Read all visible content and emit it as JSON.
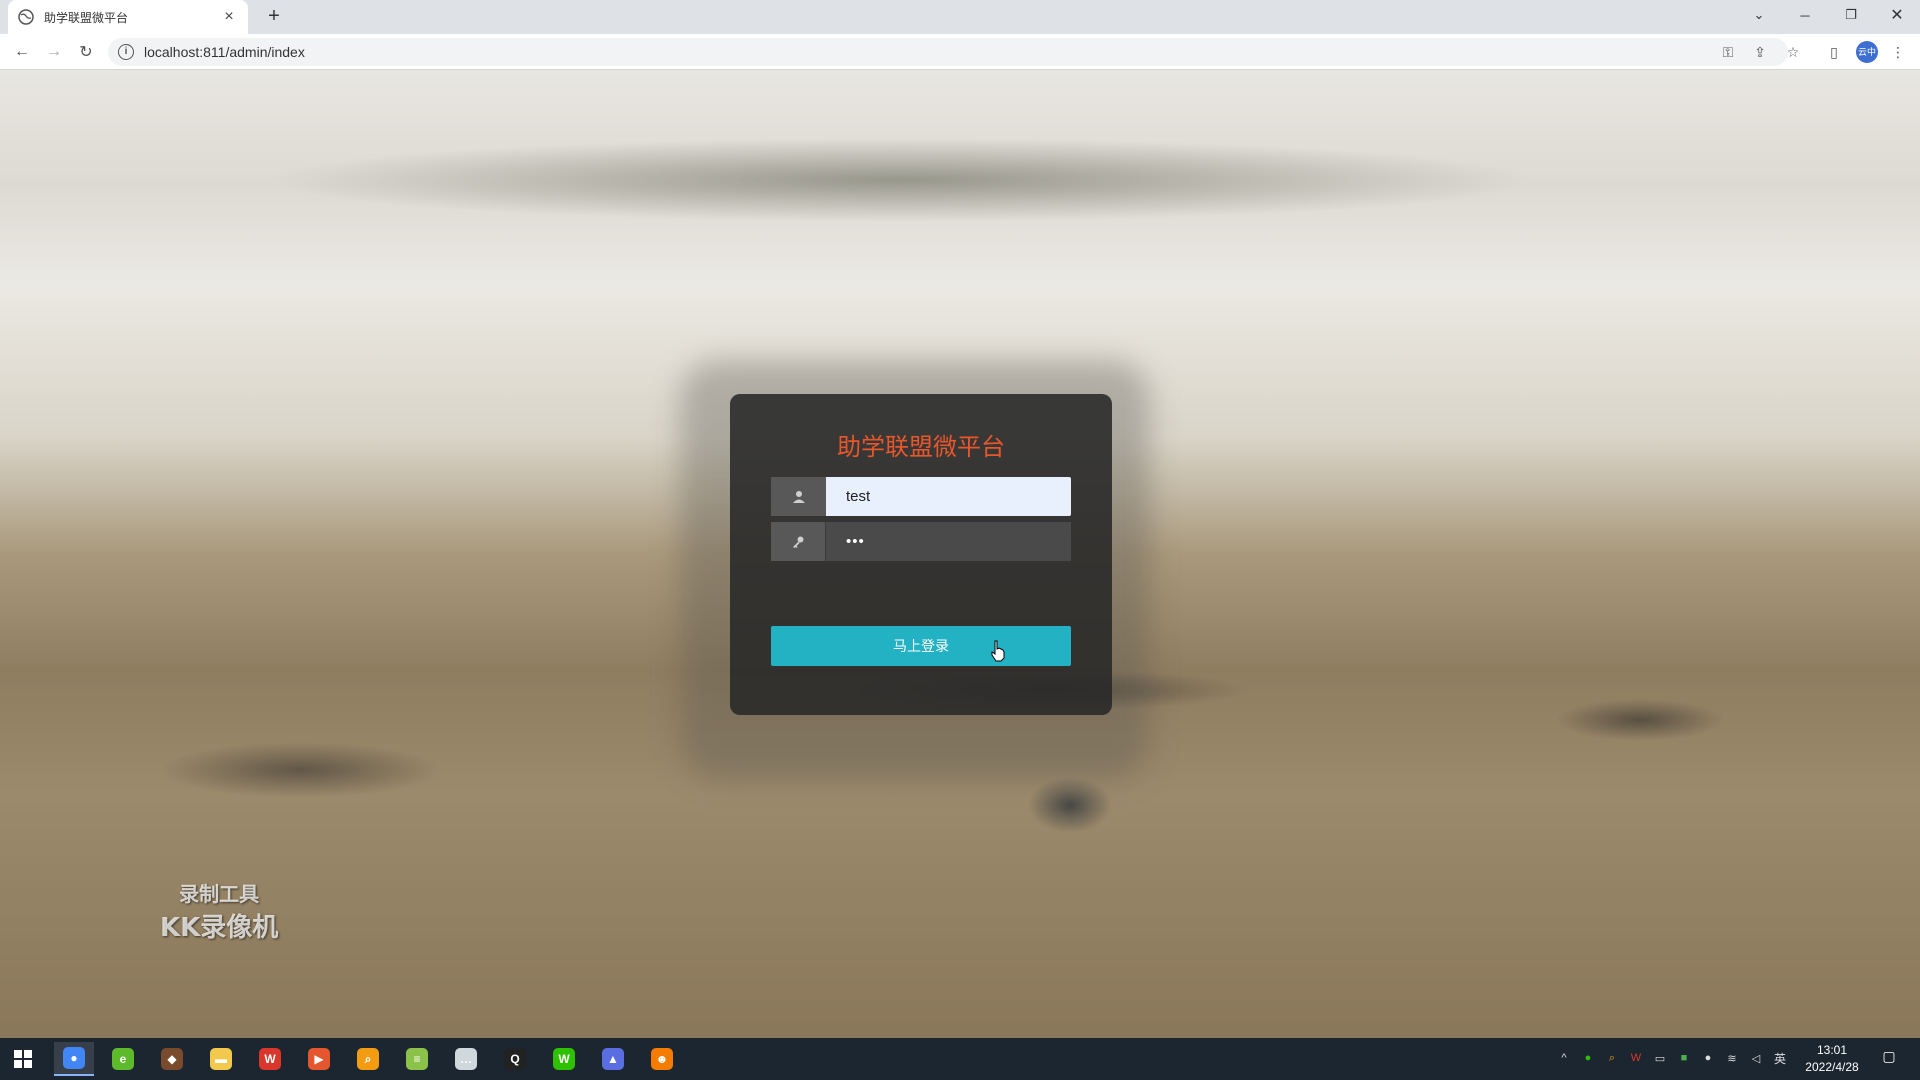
{
  "browser": {
    "tab_title": "助学联盟微平台",
    "tab_close": "×",
    "new_tab": "+",
    "url": "localhost:811/admin/index",
    "profile_initials": "云中"
  },
  "login": {
    "title": "助学联盟微平台",
    "username_value": "test",
    "password_value": "•••",
    "submit_label": "马上登录",
    "title_color": "#e8572b",
    "button_color": "#23b2c4"
  },
  "watermark": {
    "line1": "录制工具",
    "line2": "KK录像机"
  },
  "taskbar": {
    "apps": [
      {
        "name": "chrome",
        "active": true,
        "color": "#4285f4",
        "glyph": "●"
      },
      {
        "name": "360-browser",
        "active": false,
        "color": "#5dbb2b",
        "glyph": "e"
      },
      {
        "name": "game-app",
        "active": false,
        "color": "#7a4a2c",
        "glyph": "◆"
      },
      {
        "name": "file-explorer",
        "active": false,
        "color": "#f2c94c",
        "glyph": "▬"
      },
      {
        "name": "wps-office",
        "active": false,
        "color": "#d9372b",
        "glyph": "W"
      },
      {
        "name": "recorder",
        "active": false,
        "color": "#e4572e",
        "glyph": "▶"
      },
      {
        "name": "search-tool",
        "active": false,
        "color": "#f39c12",
        "glyph": "⌕"
      },
      {
        "name": "notepad",
        "active": false,
        "color": "#8bc34a",
        "glyph": "≡"
      },
      {
        "name": "chat-bubble",
        "active": false,
        "color": "#cfd8dc",
        "glyph": "…"
      },
      {
        "name": "qq",
        "active": false,
        "color": "#222222",
        "glyph": "Q"
      },
      {
        "name": "wechat",
        "active": false,
        "color": "#2dc100",
        "glyph": "W"
      },
      {
        "name": "photos",
        "active": false,
        "color": "#5b6ee1",
        "glyph": "▲"
      },
      {
        "name": "kk-recorder",
        "active": false,
        "color": "#f57c00",
        "glyph": "☻"
      }
    ],
    "ime_label": "英",
    "time": "13:01",
    "date": "2022/4/28"
  }
}
